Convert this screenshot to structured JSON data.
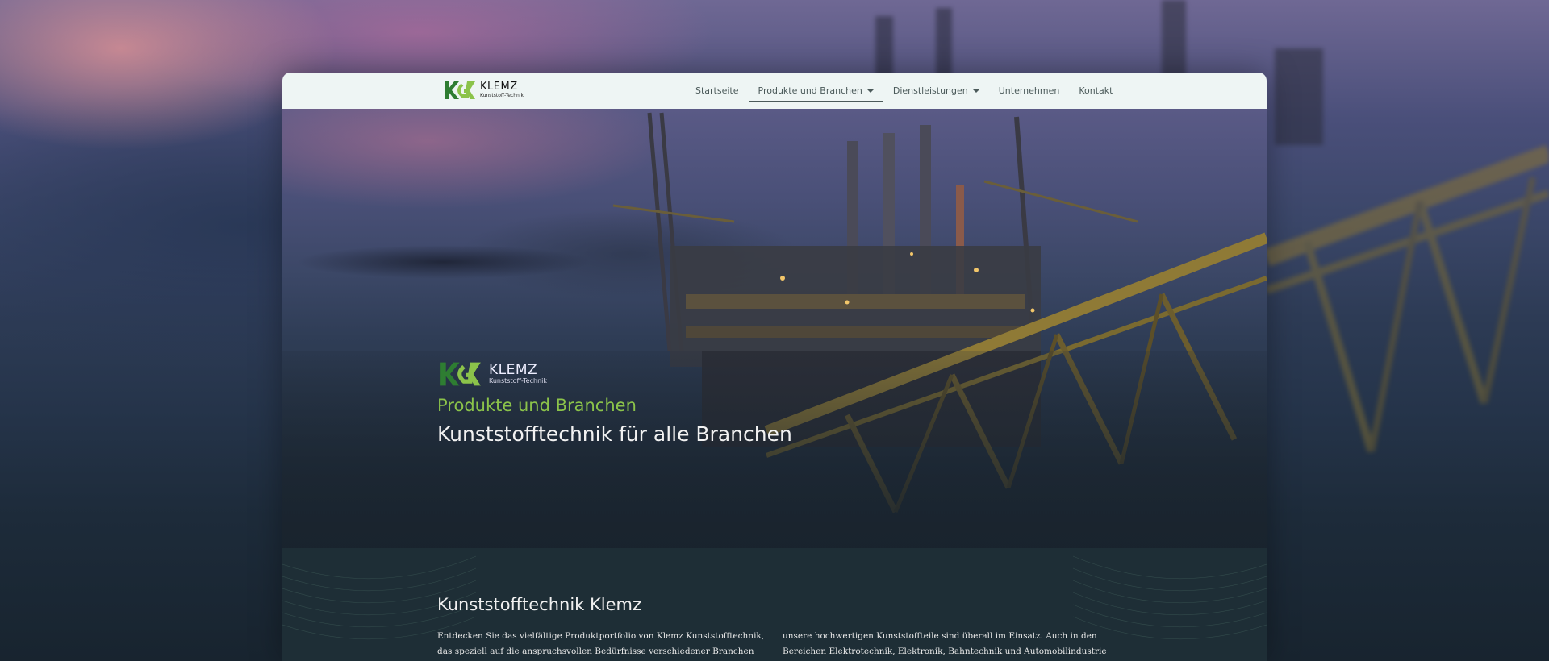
{
  "brand": {
    "name": "KLEMZ",
    "tagline": "Kunststoff-Technik"
  },
  "nav": {
    "items": [
      {
        "label": "Startseite"
      },
      {
        "label": "Produkte und Branchen"
      },
      {
        "label": "Dienstleistungen"
      },
      {
        "label": "Unternehmen"
      },
      {
        "label": "Kontakt"
      }
    ]
  },
  "hero": {
    "subtitle": "Produkte und Branchen",
    "title": "Kunststofftechnik für alle Branchen"
  },
  "section": {
    "heading": "Kunststofftechnik Klemz",
    "col1": "Entdecken Sie das vielfältige Produktportfolio von Klemz Kunststofftechnik, das speziell auf die anspruchsvollen Bedürfnisse verschiedener Branchen zugeschnitten",
    "col2": "unsere hochwertigen Kunststoffteile sind überall im Einsatz. Auch in den Bereichen Elektrotechnik, Elektronik, Bahntechnik und Automobilindustrie bieten wir"
  },
  "colors": {
    "accent": "#8bc34a",
    "nav_bg": "#eef5f4",
    "logo_dark": "#2e7d32",
    "logo_light": "#8bc34a"
  }
}
